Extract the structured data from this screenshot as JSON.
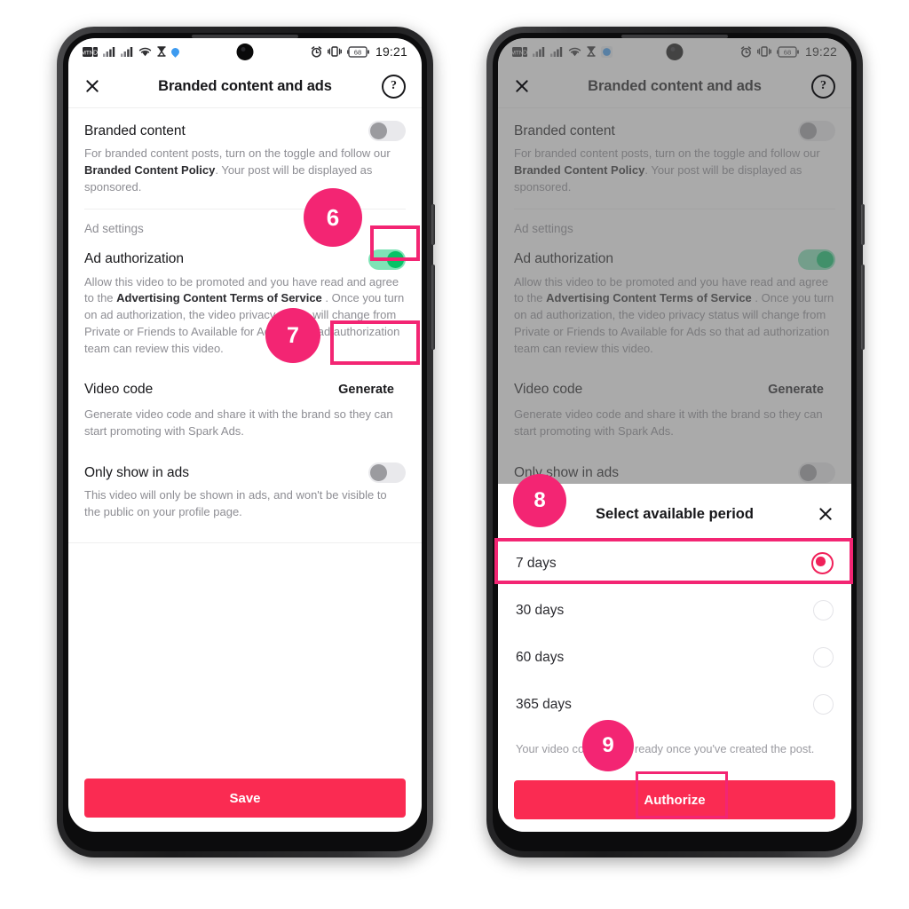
{
  "page": {
    "background": "#ffffff",
    "accent_pink": "#f32573",
    "brand_red": "#fa2b52",
    "toggle_on_color": "#07c266"
  },
  "phone_left": {
    "status_bar": {
      "time": "19:21",
      "battery_level": "68",
      "icons_left": [
        "sim-signal-icon",
        "data-icon",
        "signal-bars-icon",
        "signal-bars-2-icon",
        "wifi-icon",
        "hourglass-icon",
        "bluetooth-icon"
      ],
      "icons_right": [
        "alarm-icon",
        "vibrate-icon",
        "battery-icon"
      ]
    },
    "header": {
      "close_label": "close-icon",
      "title": "Branded content and ads",
      "help_label": "?"
    },
    "sections": {
      "branded_content": {
        "label": "Branded content",
        "toggle": "off",
        "description_1": "For branded content posts, turn on the toggle and follow our ",
        "description_bold_1": "Branded Content Policy",
        "description_2": ". Your post will be displayed as sponsored."
      },
      "ad_settings_label": "Ad settings",
      "ad_authorization": {
        "label": "Ad authorization",
        "toggle": "on",
        "description_1": "Allow this video to be promoted and you have read and agree to the ",
        "description_bold_1": "Advertising Content Terms of Service",
        "description_2": " . Once you turn on ad authorization, the video privacy status will change from Private or Friends to Available for Ads so that ad authorization team can review this video."
      },
      "video_code": {
        "label": "Video code",
        "button_label": "Generate",
        "description": "Generate video code and share it with the brand so they can start promoting with Spark Ads."
      },
      "only_show_in_ads": {
        "label": "Only show in ads",
        "toggle": "off",
        "description": "This video will only be shown in ads, and won't be visible to the public on your profile page."
      }
    },
    "save_button_label": "Save"
  },
  "phone_right": {
    "status_bar": {
      "time": "19:22",
      "battery_level": "68"
    },
    "header": {
      "title": "Branded content and ads",
      "help_label": "?"
    },
    "sections": {
      "branded_content": {
        "label": "Branded content",
        "toggle": "off",
        "description_1": "For branded content posts, turn on the toggle and follow our ",
        "description_bold_1": "Branded Content Policy",
        "description_2": ". Your post will be displayed as sponsored."
      },
      "ad_settings_label": "Ad settings",
      "ad_authorization": {
        "label": "Ad authorization",
        "toggle": "on",
        "description_1": "Allow this video to be promoted and you have read and agree to the ",
        "description_bold_1": "Advertising Content Terms of Service",
        "description_2": " . Once you turn on ad authorization, the video privacy status will change from Private or Friends to Available for Ads so that ad authorization team can review this video."
      },
      "video_code": {
        "label": "Video code",
        "button_label": "Generate",
        "description": "Generate video code and share it with the brand so they can start promoting with Spark Ads."
      },
      "only_show_in_ads": {
        "label": "Only show in ads",
        "toggle": "off",
        "description": "This video will only be shown in ads, and won't be visible to the public on your profile page."
      }
    },
    "sheet": {
      "title": "Select available period",
      "close_label": "close-icon",
      "options": [
        {
          "label": "7 days",
          "selected": true
        },
        {
          "label": "30 days",
          "selected": false
        },
        {
          "label": "60 days",
          "selected": false
        },
        {
          "label": "365 days",
          "selected": false
        }
      ],
      "note": "Your video code will be ready once you've created the post.",
      "authorize_button_label": "Authorize"
    }
  },
  "annotations": {
    "badges": [
      {
        "number": "6"
      },
      {
        "number": "7"
      },
      {
        "number": "8"
      },
      {
        "number": "9"
      }
    ]
  }
}
